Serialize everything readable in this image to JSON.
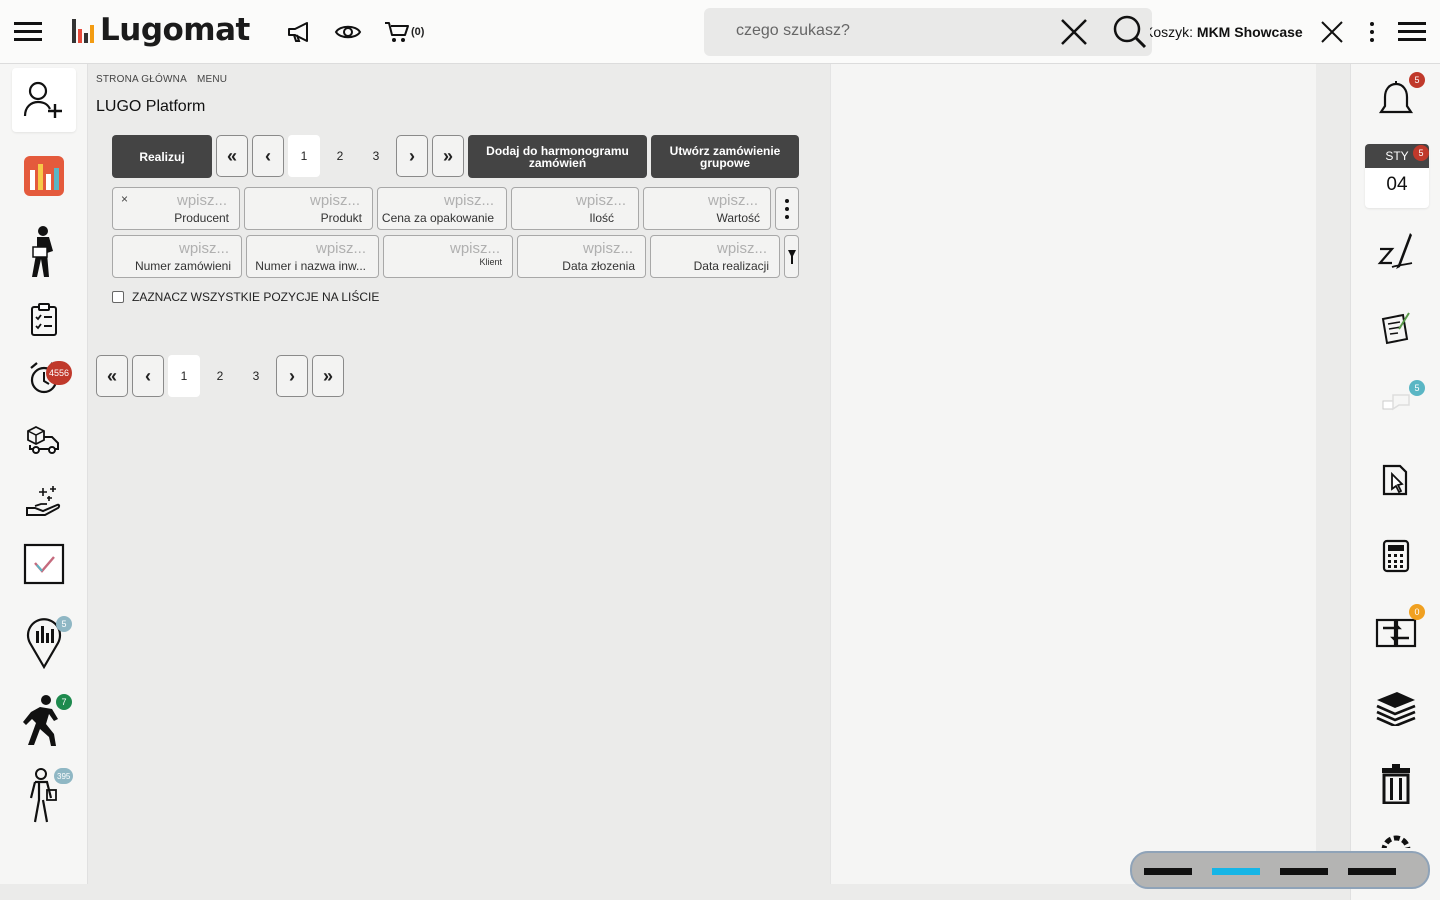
{
  "app": {
    "brand": "Lugomat"
  },
  "header": {
    "cart_count": "(0)",
    "search_placeholder": "czego szukasz?",
    "cart_prefix": "Koszyk:",
    "cart_name": "MKM Showcase"
  },
  "sidebar_left": {
    "items": [
      {
        "icon": "add-user-icon",
        "badge": ""
      },
      {
        "icon": "dashboard-chart-icon",
        "badge": ""
      },
      {
        "icon": "worker-icon",
        "badge": ""
      },
      {
        "icon": "clipboard-checklist-icon",
        "badge": ""
      },
      {
        "icon": "alarm-clock-icon",
        "badge": "4556"
      },
      {
        "icon": "delivery-truck-icon",
        "badge": ""
      },
      {
        "icon": "hand-sparkle-icon",
        "badge": ""
      },
      {
        "icon": "checkbox-icon",
        "badge": ""
      },
      {
        "icon": "location-chart-icon",
        "badge": "5"
      },
      {
        "icon": "walking-person-icon",
        "badge": "7"
      },
      {
        "icon": "person-with-bag-icon",
        "badge": "395"
      }
    ]
  },
  "breadcrumb": {
    "home": "STRONA GŁÓWNA",
    "menu": "MENU"
  },
  "page": {
    "title": "LUGO Platform"
  },
  "toolbar": {
    "realize": "Realizuj",
    "add_schedule": "Dodaj do harmonogramu zamówień",
    "create_group": "Utwórz zamówienie grupowe"
  },
  "pagination": {
    "first": "«",
    "prev": "‹",
    "next": "›",
    "last": "»",
    "pages": [
      "1",
      "2",
      "3"
    ],
    "current": "1"
  },
  "filters": {
    "placeholder": "wpisz...",
    "row1": [
      "Producent",
      "Produkt",
      "Cena za opakowanie",
      "Ilość",
      "Wartość"
    ],
    "row2": [
      "Numer zamówieni",
      "Numer i nazwa inw...",
      "Klient",
      "Data złozenia",
      "Data realizacji"
    ],
    "clear": "×"
  },
  "select_all": "ZAZNACZ WSZYSTKIE POZYCJE NA LIŚCIE",
  "sidebar_right": {
    "notifications_badge": "5",
    "calendar": {
      "month": "STY",
      "day": "04",
      "badge": "5"
    },
    "items": [
      {
        "icon": "signature-pen-icon",
        "badge": ""
      },
      {
        "icon": "document-edit-icon",
        "badge": ""
      },
      {
        "icon": "chat-bubbles-icon",
        "badge": "5"
      },
      {
        "icon": "document-pointer-icon",
        "badge": ""
      },
      {
        "icon": "calculator-icon",
        "badge": ""
      },
      {
        "icon": "exchange-icon",
        "badge": "0"
      },
      {
        "icon": "stack-icon",
        "badge": ""
      },
      {
        "icon": "trash-icon",
        "badge": ""
      }
    ]
  },
  "colors": {
    "dark_button": "#444444",
    "accent": "#15b5e6",
    "badge_red": "#c0392b"
  }
}
